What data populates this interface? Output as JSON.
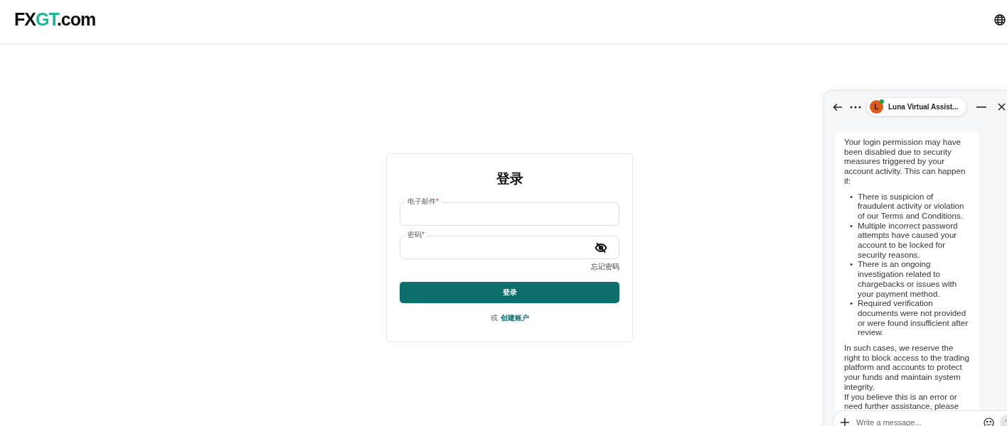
{
  "header": {
    "logo": [
      {
        "text": "FX",
        "kind": "dark"
      },
      {
        "text": "GT",
        "kind": "accent"
      },
      {
        "text": ".com",
        "kind": "dark"
      }
    ]
  },
  "login": {
    "title": "登录",
    "required_mark": "*",
    "fields": [
      {
        "label": "电子邮件",
        "required": true,
        "kind": "text"
      },
      {
        "label": "密码",
        "required": true,
        "kind": "password"
      }
    ],
    "forgot": "忘记密码",
    "submit": "登录",
    "or": "或",
    "create": "创建账户"
  },
  "chat": {
    "assistant": "Luna Virtual Assist...",
    "avatar": "L",
    "online": true,
    "message": {
      "intro": "Your login permission may have been disabled due to security measures triggered by your account activity. This can happen if:",
      "bullet": "•",
      "bullets": [
        "There is suspicion of fraudulent activity or violation of our Terms and Conditions.",
        "Multiple incorrect password attempts have caused your account to be locked for security reasons.",
        "There is an ongoing investigation related to chargebacks or issues with your payment method.",
        "Required verification documents were not provided or were found insufficient after review."
      ],
      "outro": [
        "In such cases, we reserve the right to block access to the trading platform and accounts to protect your funds and maintain system integrity.",
        "If you believe this is an error or need further assistance, please"
      ]
    },
    "input": {
      "placeholder": "Write a message..."
    }
  }
}
